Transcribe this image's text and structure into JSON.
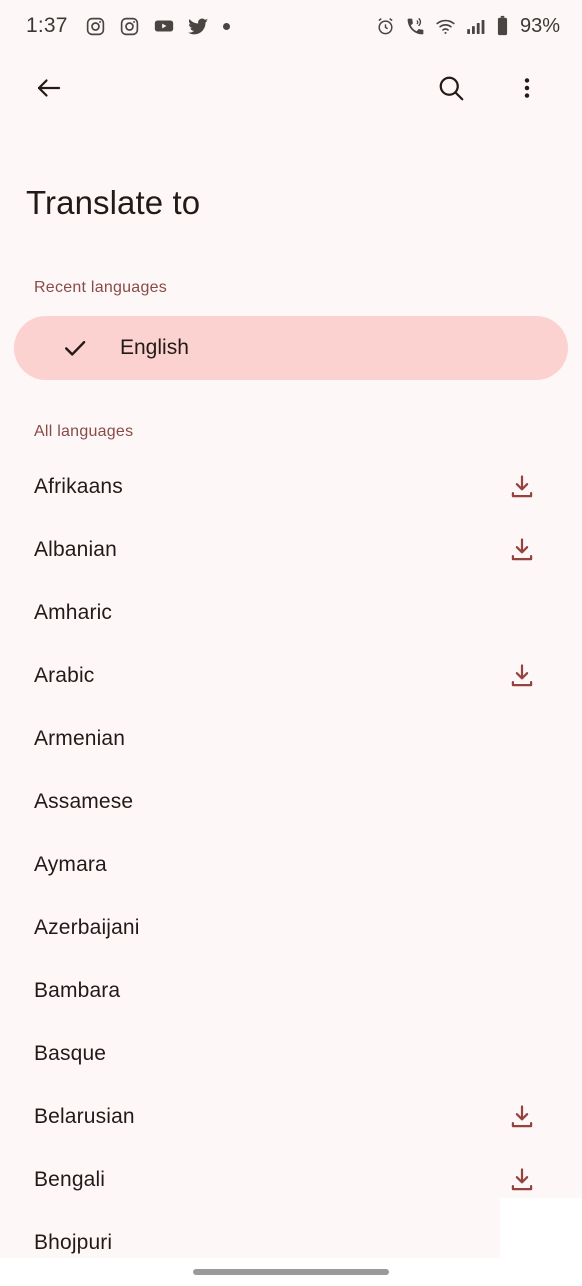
{
  "status_bar": {
    "time": "1:37",
    "battery_percent": "93%",
    "left_icons": [
      "instagram-icon",
      "instagram-icon",
      "youtube-icon",
      "twitter-icon",
      "notification-dot"
    ],
    "right_icons": [
      "alarm-icon",
      "wifi-calling-icon",
      "wifi-icon",
      "signal-icon",
      "battery-icon"
    ]
  },
  "toolbar": {
    "back_icon": "back-arrow-icon",
    "search_icon": "search-icon",
    "overflow_icon": "more-vert-icon"
  },
  "page": {
    "title": "Translate to"
  },
  "recent_section": {
    "header": "Recent languages",
    "items": [
      {
        "label": "English",
        "selected": true
      }
    ]
  },
  "all_section": {
    "header": "All languages",
    "items": [
      {
        "label": "Afrikaans",
        "downloadable": true
      },
      {
        "label": "Albanian",
        "downloadable": true
      },
      {
        "label": "Amharic",
        "downloadable": false
      },
      {
        "label": "Arabic",
        "downloadable": true
      },
      {
        "label": "Armenian",
        "downloadable": false
      },
      {
        "label": "Assamese",
        "downloadable": false
      },
      {
        "label": "Aymara",
        "downloadable": false
      },
      {
        "label": "Azerbaijani",
        "downloadable": false
      },
      {
        "label": "Bambara",
        "downloadable": false
      },
      {
        "label": "Basque",
        "downloadable": false
      },
      {
        "label": "Belarusian",
        "downloadable": true
      },
      {
        "label": "Bengali",
        "downloadable": true
      },
      {
        "label": "Bhojpuri",
        "downloadable": false
      }
    ]
  },
  "colors": {
    "background": "#FDF8F7",
    "selected_pill": "#FBD2CF",
    "section_header": "#8A4A47",
    "download_icon": "#97413E",
    "text_primary": "#231A18",
    "nav_pill": "#9A9A9A"
  },
  "nav_bar": {
    "gesture_pill": "home-gesture-pill"
  }
}
